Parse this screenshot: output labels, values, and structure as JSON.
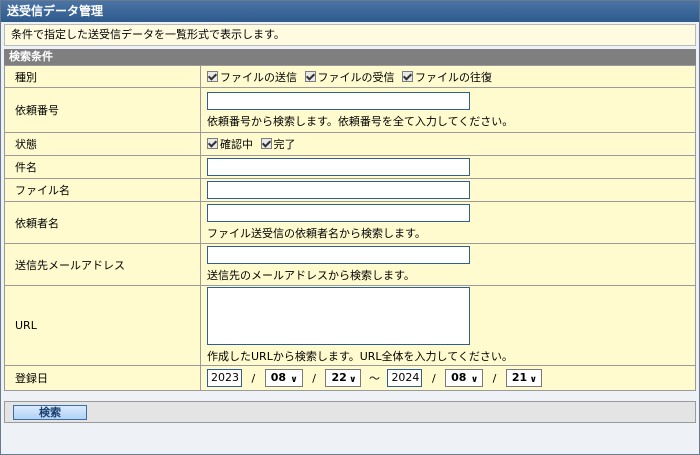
{
  "page": {
    "title": "送受信データ管理",
    "description": "条件で指定した送受信データを一覧形式で表示します。",
    "section_title": "検索条件"
  },
  "form": {
    "type": {
      "label": "種別",
      "options": [
        "ファイルの送信",
        "ファイルの受信",
        "ファイルの往復"
      ]
    },
    "request_no": {
      "label": "依頼番号",
      "hint": "依頼番号から検索します。依頼番号を全て入力してください。"
    },
    "status": {
      "label": "状態",
      "options": [
        "確認中",
        "完了"
      ]
    },
    "subject": {
      "label": "件名"
    },
    "file_name": {
      "label": "ファイル名"
    },
    "requester": {
      "label": "依頼者名",
      "hint": "ファイル送受信の依頼者名から検索します。"
    },
    "dest_email": {
      "label": "送信先メールアドレス",
      "hint": "送信先のメールアドレスから検索します。"
    },
    "url": {
      "label": "URL",
      "hint": "作成したURLから検索します。URL全体を入力してください。"
    },
    "reg_date": {
      "label": "登録日",
      "from_year": "2023",
      "from_month": "08",
      "from_day": "22",
      "to_year": "2024",
      "to_month": "08",
      "to_day": "21",
      "slash": "/",
      "tilde": "～"
    }
  },
  "search_button": "検索"
}
